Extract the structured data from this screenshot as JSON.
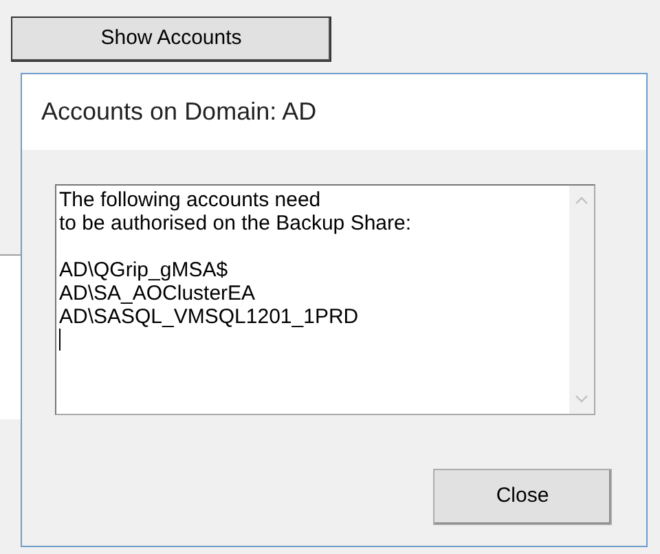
{
  "show_accounts_button": {
    "label": "Show Accounts"
  },
  "dialog": {
    "title": "Accounts on Domain: AD",
    "text_area": {
      "value": "The following accounts need\nto be authorised on the Backup Share:\n\nAD\\QGrip_gMSA$\nAD\\SA_AOClusterEA\nAD\\SASQL_VMSQL1201_1PRD\n"
    },
    "buttons": [
      {
        "label": "Close"
      }
    ]
  }
}
